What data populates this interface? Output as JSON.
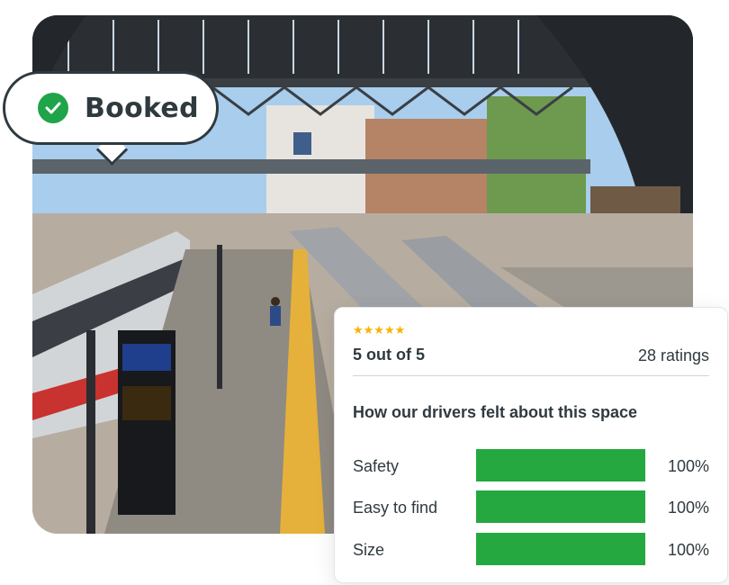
{
  "badge": {
    "label": "Booked",
    "icon": "check-circle-icon",
    "color": "#1fa44a"
  },
  "summary": {
    "stars": "★★★★★",
    "score": "5 out of 5",
    "count": "28 ratings"
  },
  "section_title": "How our drivers felt about this space",
  "metrics": [
    {
      "label": "Safety",
      "value": 1.0,
      "pct": "100%"
    },
    {
      "label": "Easy to find",
      "value": 1.0,
      "pct": "100%"
    },
    {
      "label": "Size",
      "value": 1.0,
      "pct": "100%"
    }
  ],
  "photo": {
    "subject": "railway-station-platform"
  },
  "colors": {
    "bar": "#24a83f",
    "stars": "#f5b400"
  }
}
